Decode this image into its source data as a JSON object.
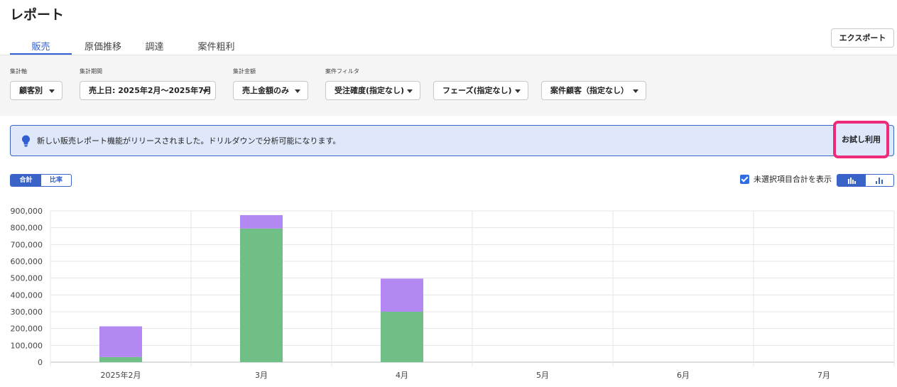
{
  "page": {
    "title": "レポート"
  },
  "tabs": [
    {
      "label": "販売",
      "active": true
    },
    {
      "label": "原価推移",
      "active": false
    },
    {
      "label": "調達",
      "active": false
    },
    {
      "label": "案件粗利",
      "active": false
    }
  ],
  "toolbar": {
    "export_label": "エクスポート"
  },
  "filters": {
    "aggregation_axis": {
      "label": "集計軸",
      "value": "顧客別"
    },
    "period": {
      "label": "集計期間",
      "value": "売上日: 2025年2月〜2025年7月"
    },
    "amount": {
      "label": "集計金額",
      "value": "売上金額のみ"
    },
    "project_filter": {
      "label": "案件フィルタ",
      "order_probability": "受注確度(指定なし)",
      "phase": "フェーズ(指定なし)",
      "customer": "案件顧客（指定なし）"
    }
  },
  "banner": {
    "icon": "lightbulb-icon",
    "text": "新しい販売レポート機能がリリースされました。ドリルダウンで分析可能になります。",
    "button_label": "お試し利用",
    "highlight_color": "#ee2a7b"
  },
  "display_mode": {
    "total_label": "合計",
    "ratio_label": "比率",
    "selected": "合計"
  },
  "options": {
    "show_unselected_total_label": "未選択項目合計を表示",
    "show_unselected_total_checked": true
  },
  "chart_type_toggle": [
    {
      "icon": "stacked-bar-chart-icon",
      "selected": true
    },
    {
      "icon": "bar-chart-icon",
      "selected": false
    }
  ],
  "chart_data": {
    "type": "bar",
    "stacked": true,
    "categories": [
      "2025年2月",
      "3月",
      "4月",
      "5月",
      "6月",
      "7月"
    ],
    "series": [
      {
        "color": "#70bf87",
        "values": [
          30000,
          795000,
          300000,
          0,
          0,
          0
        ]
      },
      {
        "color": "#b388f2",
        "values": [
          183000,
          80000,
          197000,
          0,
          0,
          0
        ]
      }
    ],
    "ylim": [
      0,
      900000
    ],
    "yticks": [
      "900,000",
      "800,000",
      "700,000",
      "600,000",
      "500,000",
      "400,000",
      "300,000",
      "200,000",
      "100,000",
      "0"
    ],
    "grid": true,
    "legend": "none"
  }
}
